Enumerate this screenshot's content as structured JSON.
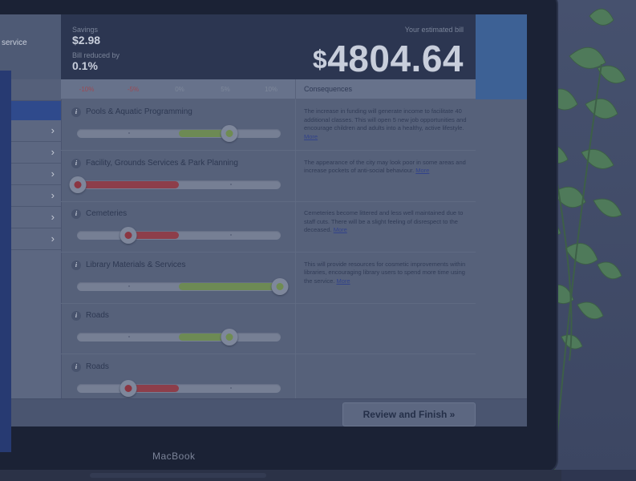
{
  "app": {
    "left_panel": {
      "header_label": "service",
      "items_count_visible": 6
    },
    "summary": {
      "savings_label": "Savings",
      "savings_value": "$2.98",
      "reduction_label": "Bill reduced by",
      "reduction_value": "0.1%",
      "bill_label": "Your estimated bill",
      "bill_currency": "$",
      "bill_value": "4804.64"
    },
    "scale": {
      "ticks": [
        {
          "label": "-10%",
          "negative": true
        },
        {
          "label": "-5%",
          "negative": true
        },
        {
          "label": "0%",
          "negative": false
        },
        {
          "label": "5%",
          "negative": false
        },
        {
          "label": "10%",
          "negative": false
        }
      ],
      "consequences_header": "Consequences"
    },
    "rows": [
      {
        "title": "Pools & Aquatic Programming",
        "change_pct": 5,
        "consequence": "The increase in funding will generate income to facilitate 40 additional classes. This will open 5 new job opportunities and encourage children and adults into a healthy, active lifestyle.",
        "more": "More"
      },
      {
        "title": "Facility, Grounds Services & Park Planning",
        "change_pct": -10,
        "consequence": "The appearance of the city may look poor in some areas and increase pockets of anti-social behaviour.",
        "more": "More"
      },
      {
        "title": "Cemeteries",
        "change_pct": -5,
        "consequence": "Cemeteries become littered and less well maintained due to staff cuts. There will be a slight feeling of disrespect to the deceased.",
        "more": "More"
      },
      {
        "title": "Library Materials & Services",
        "change_pct": 10,
        "consequence": "This will provide resources for cosmetic improvements within libraries, encouraging library users to spend more time using the service.",
        "more": "More"
      },
      {
        "title": "Roads",
        "change_pct": 5,
        "consequence": "",
        "more": ""
      },
      {
        "title": "Roads",
        "change_pct": -5,
        "consequence": "",
        "more": ""
      }
    ],
    "footer": {
      "finish_label": "Review and Finish »"
    },
    "device_label": "MacBook"
  },
  "colors": {
    "increase": "#6d8a54",
    "decrease": "#8d3e4a",
    "accent_blue": "#3d6195"
  }
}
